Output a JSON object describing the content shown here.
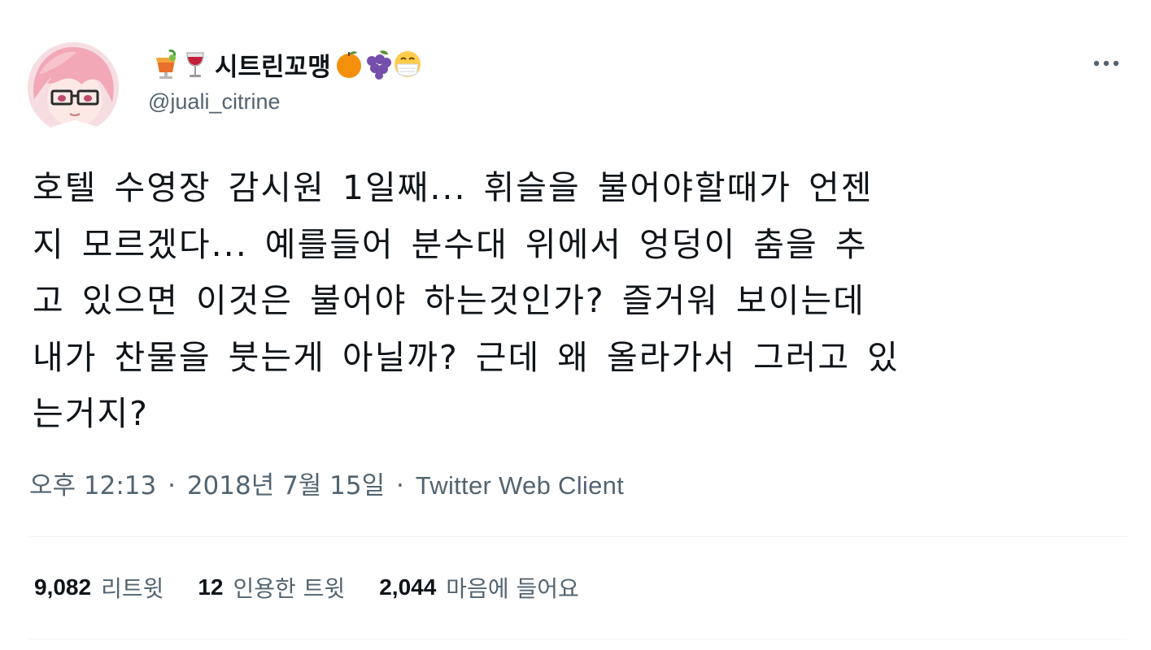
{
  "user": {
    "display_name": "시트린꼬맹",
    "handle": "@juali_citrine",
    "leading_emoji": [
      "tropical-drink",
      "wine-glass"
    ],
    "trailing_emoji": [
      "tangerine",
      "grapes",
      "face-with-medical-mask"
    ]
  },
  "tweet": {
    "lines": [
      "호텔 수영장 감시원 1일째... 휘슬을 불어야할때가 언젠",
      "지 모르겠다... 예를들어 분수대 위에서 엉덩이 춤을 추",
      "고 있으면 이것은 불어야 하는것인가? 즐거워 보이는데",
      "내가 찬물을 붓는게 아닐까? 근데 왜 올라가서 그러고 있",
      "는거지?"
    ],
    "time": "오후 12:13",
    "separator": "·",
    "date": "2018년 7월 15일",
    "source": "Twitter Web Client"
  },
  "stats": {
    "retweets": {
      "count": "9,082",
      "label": "리트윗"
    },
    "quotes": {
      "count": "12",
      "label": "인용한 트윗"
    },
    "likes": {
      "count": "2,044",
      "label": "마음에 들어요"
    }
  },
  "colors": {
    "text": "#0f1419",
    "secondary": "#536471",
    "divider": "#eff3f4"
  },
  "icons": {
    "more": "more-horizontal-icon"
  }
}
